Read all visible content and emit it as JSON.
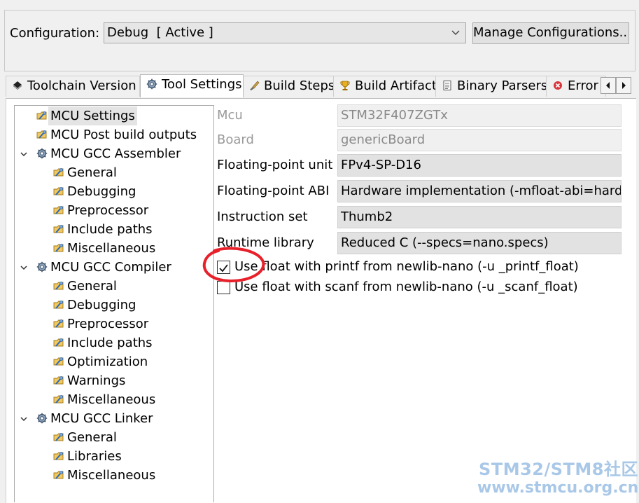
{
  "config": {
    "label": "Configuration:",
    "selected": "Debug  [ Active ]",
    "manage_button": "Manage Configurations..."
  },
  "tabs": [
    {
      "label": "Toolchain  Version",
      "icon": "chip-icon",
      "active": false
    },
    {
      "label": "Tool Settings",
      "icon": "gear-icon",
      "active": true
    },
    {
      "label": "Build Steps",
      "icon": "brush-icon",
      "active": false
    },
    {
      "label": "Build Artifact",
      "icon": "trophy-icon",
      "active": false
    },
    {
      "label": "Binary Parsers",
      "icon": "document-icon",
      "active": false
    },
    {
      "label": "Error",
      "icon": "error-icon",
      "active": false
    }
  ],
  "tree": {
    "items": [
      {
        "label": "MCU Settings",
        "level": 0,
        "icon": "tool-settings-icon",
        "selected": true
      },
      {
        "label": "MCU Post build outputs",
        "level": 0,
        "icon": "tool-settings-icon"
      },
      {
        "label": "MCU GCC Assembler",
        "level": 0,
        "icon": "gear-icon",
        "expanded": true
      },
      {
        "label": "General",
        "level": 1,
        "icon": "tool-settings-icon"
      },
      {
        "label": "Debugging",
        "level": 1,
        "icon": "tool-settings-icon"
      },
      {
        "label": "Preprocessor",
        "level": 1,
        "icon": "tool-settings-icon"
      },
      {
        "label": "Include paths",
        "level": 1,
        "icon": "tool-settings-icon"
      },
      {
        "label": "Miscellaneous",
        "level": 1,
        "icon": "tool-settings-icon"
      },
      {
        "label": "MCU GCC Compiler",
        "level": 0,
        "icon": "gear-icon",
        "expanded": true
      },
      {
        "label": "General",
        "level": 1,
        "icon": "tool-settings-icon"
      },
      {
        "label": "Debugging",
        "level": 1,
        "icon": "tool-settings-icon"
      },
      {
        "label": "Preprocessor",
        "level": 1,
        "icon": "tool-settings-icon"
      },
      {
        "label": "Include paths",
        "level": 1,
        "icon": "tool-settings-icon"
      },
      {
        "label": "Optimization",
        "level": 1,
        "icon": "tool-settings-icon"
      },
      {
        "label": "Warnings",
        "level": 1,
        "icon": "tool-settings-icon"
      },
      {
        "label": "Miscellaneous",
        "level": 1,
        "icon": "tool-settings-icon"
      },
      {
        "label": "MCU GCC Linker",
        "level": 0,
        "icon": "gear-icon",
        "expanded": true
      },
      {
        "label": "General",
        "level": 1,
        "icon": "tool-settings-icon"
      },
      {
        "label": "Libraries",
        "level": 1,
        "icon": "tool-settings-icon"
      },
      {
        "label": "Miscellaneous",
        "level": 1,
        "icon": "tool-settings-icon"
      }
    ]
  },
  "settings": {
    "fields": [
      {
        "label": "Mcu",
        "value": "STM32F407ZGTx",
        "disabled": true
      },
      {
        "label": "Board",
        "value": "genericBoard",
        "disabled": true
      },
      {
        "label": "Floating-point unit",
        "value": "FPv4-SP-D16",
        "disabled": false
      },
      {
        "label": "Floating-point ABI",
        "value": "Hardware implementation (-mfloat-abi=hard)",
        "disabled": false
      },
      {
        "label": "Instruction set",
        "value": "Thumb2",
        "disabled": false
      },
      {
        "label": "Runtime library",
        "value": "Reduced C (--specs=nano.specs)",
        "disabled": false
      }
    ],
    "checkboxes": [
      {
        "label": "Use float with printf from newlib-nano (-u _printf_float)",
        "checked": true
      },
      {
        "label": "Use float with scanf from newlib-nano (-u _scanf_float)",
        "checked": false
      }
    ]
  },
  "annotation": {
    "color": "#e8202a"
  },
  "watermark": {
    "line1": "STM32/STM8社区",
    "line2": "www.stmcu.org.cn",
    "color": "#a9c8e8"
  }
}
